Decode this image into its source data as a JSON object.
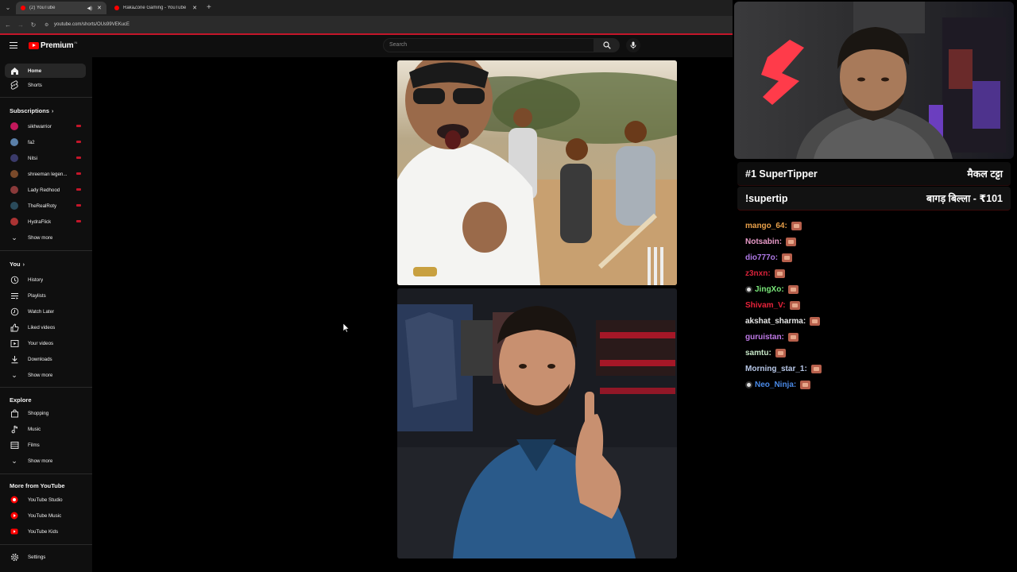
{
  "browser": {
    "tabs": [
      {
        "title": "(2) YouTube",
        "active": true
      },
      {
        "title": "RakaZone Gaming - YouTube",
        "active": false
      }
    ],
    "url": "youtube.com/shorts/OUs99VEKucE"
  },
  "youtube": {
    "logo_text": "Premium",
    "logo_sup": "IN",
    "search_placeholder": "Search"
  },
  "sidebar": {
    "main": [
      {
        "label": "Home",
        "icon": "home-icon",
        "active": true
      },
      {
        "label": "Shorts",
        "icon": "shorts-icon",
        "active": false
      }
    ],
    "subscriptions_title": "Subscriptions",
    "subscriptions": [
      {
        "label": "sikhwarrior",
        "color": "#c2185b",
        "live": true
      },
      {
        "label": "fa2",
        "color": "#5a7fa8",
        "live": true
      },
      {
        "label": "Nitsi",
        "color": "#3a3a6a",
        "live": true
      },
      {
        "label": "shreeman legen...",
        "color": "#7a4a2a",
        "live": true
      },
      {
        "label": "Lady Redhood",
        "color": "#8a3a3a",
        "live": true
      },
      {
        "label": "TheRealRoty",
        "color": "#2a4a5a",
        "live": true
      },
      {
        "label": "HydraFlick",
        "color": "#a33",
        "live": true
      }
    ],
    "subs_show_more": "Show more",
    "you_title": "You",
    "you": [
      {
        "label": "History",
        "icon": "history-icon"
      },
      {
        "label": "Playlists",
        "icon": "playlists-icon"
      },
      {
        "label": "Watch Later",
        "icon": "watch-later-icon"
      },
      {
        "label": "Liked videos",
        "icon": "like-icon"
      },
      {
        "label": "Your videos",
        "icon": "your-videos-icon"
      },
      {
        "label": "Downloads",
        "icon": "download-icon"
      }
    ],
    "you_show_more": "Show more",
    "explore_title": "Explore",
    "explore": [
      {
        "label": "Shopping",
        "icon": "shopping-icon"
      },
      {
        "label": "Music",
        "icon": "music-icon"
      },
      {
        "label": "Films",
        "icon": "films-icon"
      }
    ],
    "explore_show_more": "Show more",
    "more_title": "More from YouTube",
    "more": [
      {
        "label": "YouTube Studio",
        "icon": "youtube-studio-icon"
      },
      {
        "label": "YouTube Music",
        "icon": "youtube-music-icon"
      },
      {
        "label": "YouTube Kids",
        "icon": "youtube-kids-icon"
      }
    ],
    "settings": "Settings"
  },
  "overlay": {
    "tipper1_left": "#1 SuperTipper",
    "tipper1_right": "मैकल टट्टा",
    "tipper2_left": "!supertip",
    "tipper2_right": "बागड़ बिल्ला - ₹101",
    "chat": [
      {
        "name": "mango_64:",
        "color": "#e8a04a",
        "badge": false
      },
      {
        "name": "Notsabin:",
        "color": "#e89ac8",
        "badge": false
      },
      {
        "name": "dio777o:",
        "color": "#b07ae8",
        "badge": false
      },
      {
        "name": "z3nxn:",
        "color": "#d8223a",
        "badge": false
      },
      {
        "name": "JingXo:",
        "color": "#7ae87a",
        "badge": true
      },
      {
        "name": "Shivam_V:",
        "color": "#e8223a",
        "badge": false
      },
      {
        "name": "akshat_sharma:",
        "color": "#e8e8e8",
        "badge": false
      },
      {
        "name": "guruistan:",
        "color": "#c07ae8",
        "badge": false
      },
      {
        "name": "samtu:",
        "color": "#c8e8c8",
        "badge": false
      },
      {
        "name": "Morning_star_1:",
        "color": "#b8c8e8",
        "badge": false
      },
      {
        "name": "Neo_Ninja:",
        "color": "#4a8ae8",
        "badge": true
      }
    ]
  }
}
